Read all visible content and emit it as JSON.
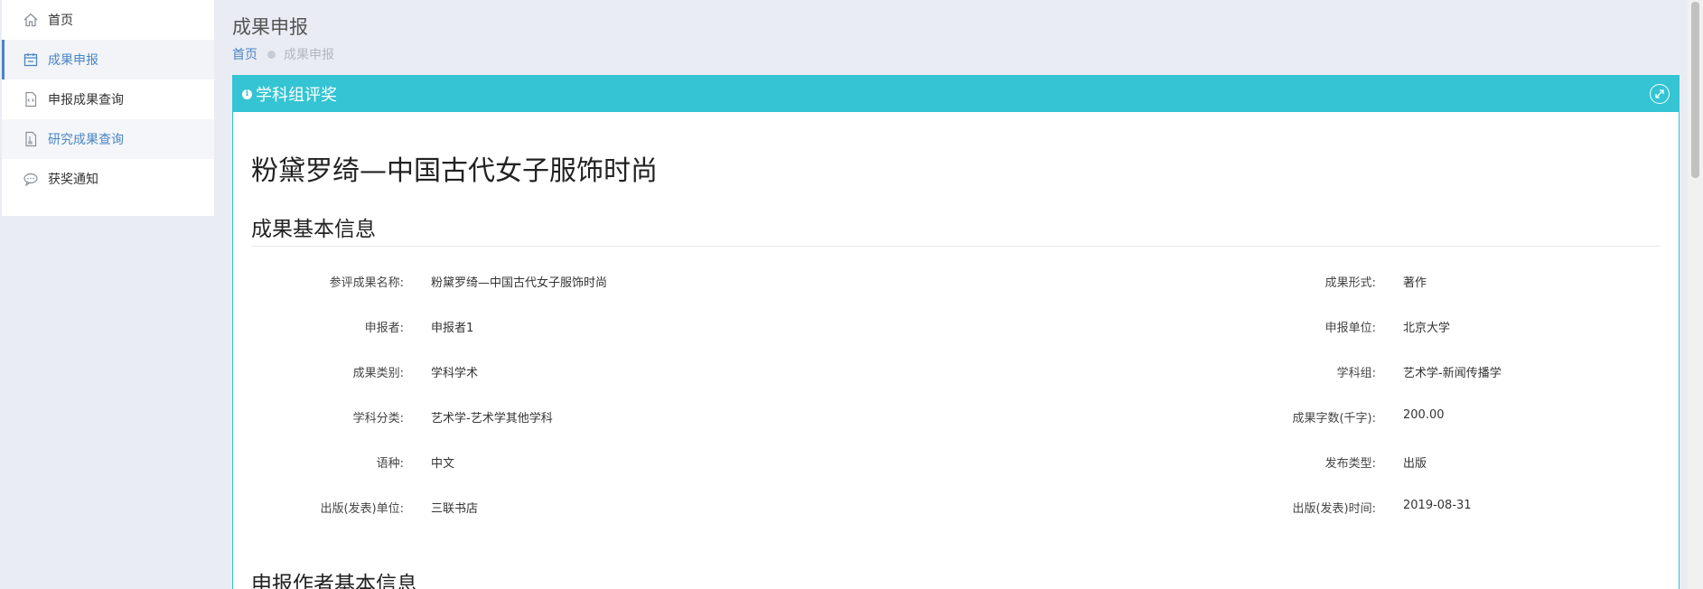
{
  "sidebar": {
    "items": [
      {
        "label": "首页",
        "icon": "home-icon"
      },
      {
        "label": "成果申报",
        "icon": "calendar-icon"
      },
      {
        "label": "申报成果查询",
        "icon": "code-file-icon"
      },
      {
        "label": "研究成果查询",
        "icon": "file-icon"
      },
      {
        "label": "获奖通知",
        "icon": "chat-icon"
      }
    ]
  },
  "header": {
    "title": "成果申报",
    "breadcrumb": {
      "home": "首页",
      "current": "成果申报"
    }
  },
  "panel": {
    "title": "学科组评奖",
    "main_title": "粉黛罗绮—中国古代女子服饰时尚",
    "section1": "成果基本信息",
    "section2": "申报作者基本信息",
    "rows": [
      {
        "l_label": "参评成果名称:",
        "l_value": "粉黛罗绮—中国古代女子服饰时尚",
        "r_label": "成果形式:",
        "r_value": "著作"
      },
      {
        "l_label": "申报者:",
        "l_value": "申报者1",
        "r_label": "申报单位:",
        "r_value": "北京大学"
      },
      {
        "l_label": "成果类别:",
        "l_value": "学科学术",
        "r_label": "学科组:",
        "r_value": "艺术学-新闻传播学"
      },
      {
        "l_label": "学科分类:",
        "l_value": "艺术学-艺术学其他学科",
        "r_label": "成果字数(千字):",
        "r_value": "200.00"
      },
      {
        "l_label": "语种:",
        "l_value": "中文",
        "r_label": "发布类型:",
        "r_value": "出版"
      },
      {
        "l_label": "出版(发表)单位:",
        "l_value": "三联书店",
        "r_label": "出版(发表)时间:",
        "r_value": "2019-08-31"
      }
    ]
  },
  "colors": {
    "accent": "#34c4d3",
    "link": "#4a86c5"
  }
}
